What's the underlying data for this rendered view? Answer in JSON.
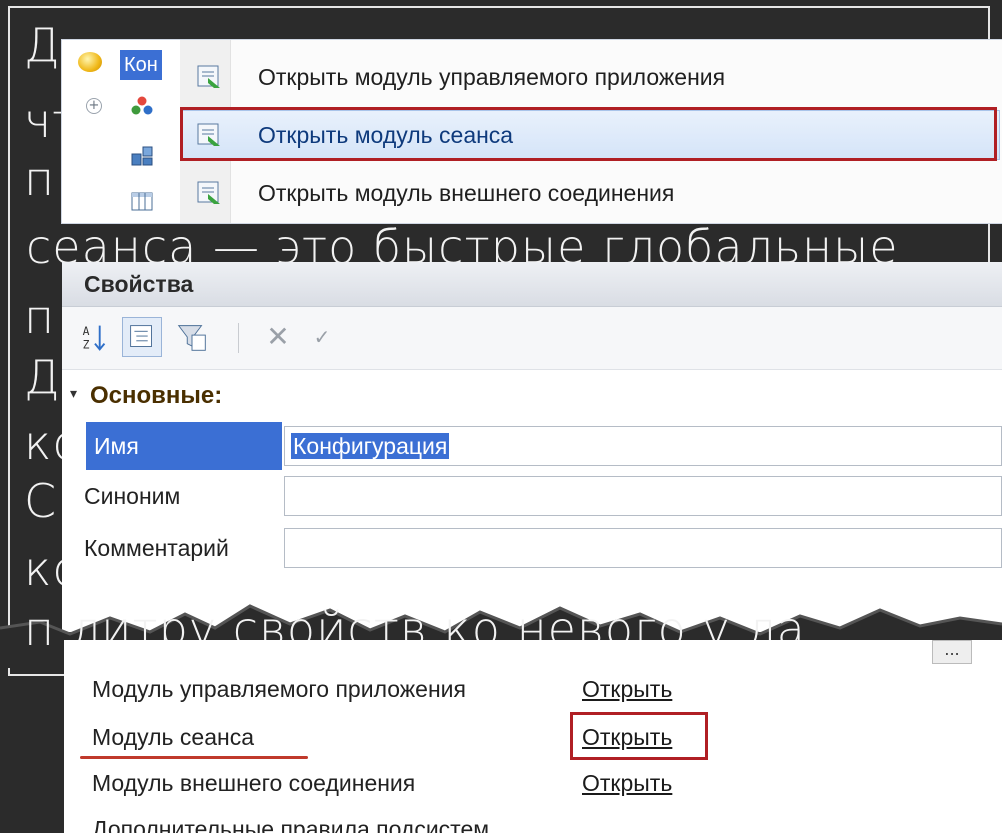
{
  "slide": {
    "line1": "Д",
    "line2": "чт",
    "line3": "п",
    "line4": "сеанса — это быстрые глобальные",
    "line5": "п",
    "line6": "Д",
    "line7": "ко",
    "line8": "С",
    "line9": "ко",
    "line10": "п  литру свойств ко  невого у  ла"
  },
  "tree": {
    "root_label": "Кон",
    "expand_glyph": "+"
  },
  "context_menu": {
    "items": [
      {
        "label": "Открыть модуль управляемого приложения"
      },
      {
        "label": "Открыть модуль сеанса"
      },
      {
        "label": "Открыть модуль внешнего соединения"
      }
    ]
  },
  "properties": {
    "title": "Свойства",
    "toolbar": {
      "close_glyph": "✕",
      "check_glyph": "✓"
    },
    "group": {
      "caret": "▾",
      "label": "Основные:"
    },
    "rows": [
      {
        "label": "Имя",
        "value": "Конфигурация"
      },
      {
        "label": "Синоним",
        "value": ""
      },
      {
        "label": "Комментарий",
        "value": ""
      }
    ]
  },
  "modules": {
    "more_glyph": "...",
    "items": [
      {
        "label": "Модуль управляемого приложения",
        "link": "Открыть"
      },
      {
        "label": "Модуль сеанса",
        "link": "Открыть"
      },
      {
        "label": "Модуль внешнего соединения",
        "link": "Открыть"
      }
    ],
    "partial": "Дополнительные правила подсистем"
  },
  "colors": {
    "highlight_red": "#b01f24",
    "selection_blue": "#3b6fd4"
  }
}
